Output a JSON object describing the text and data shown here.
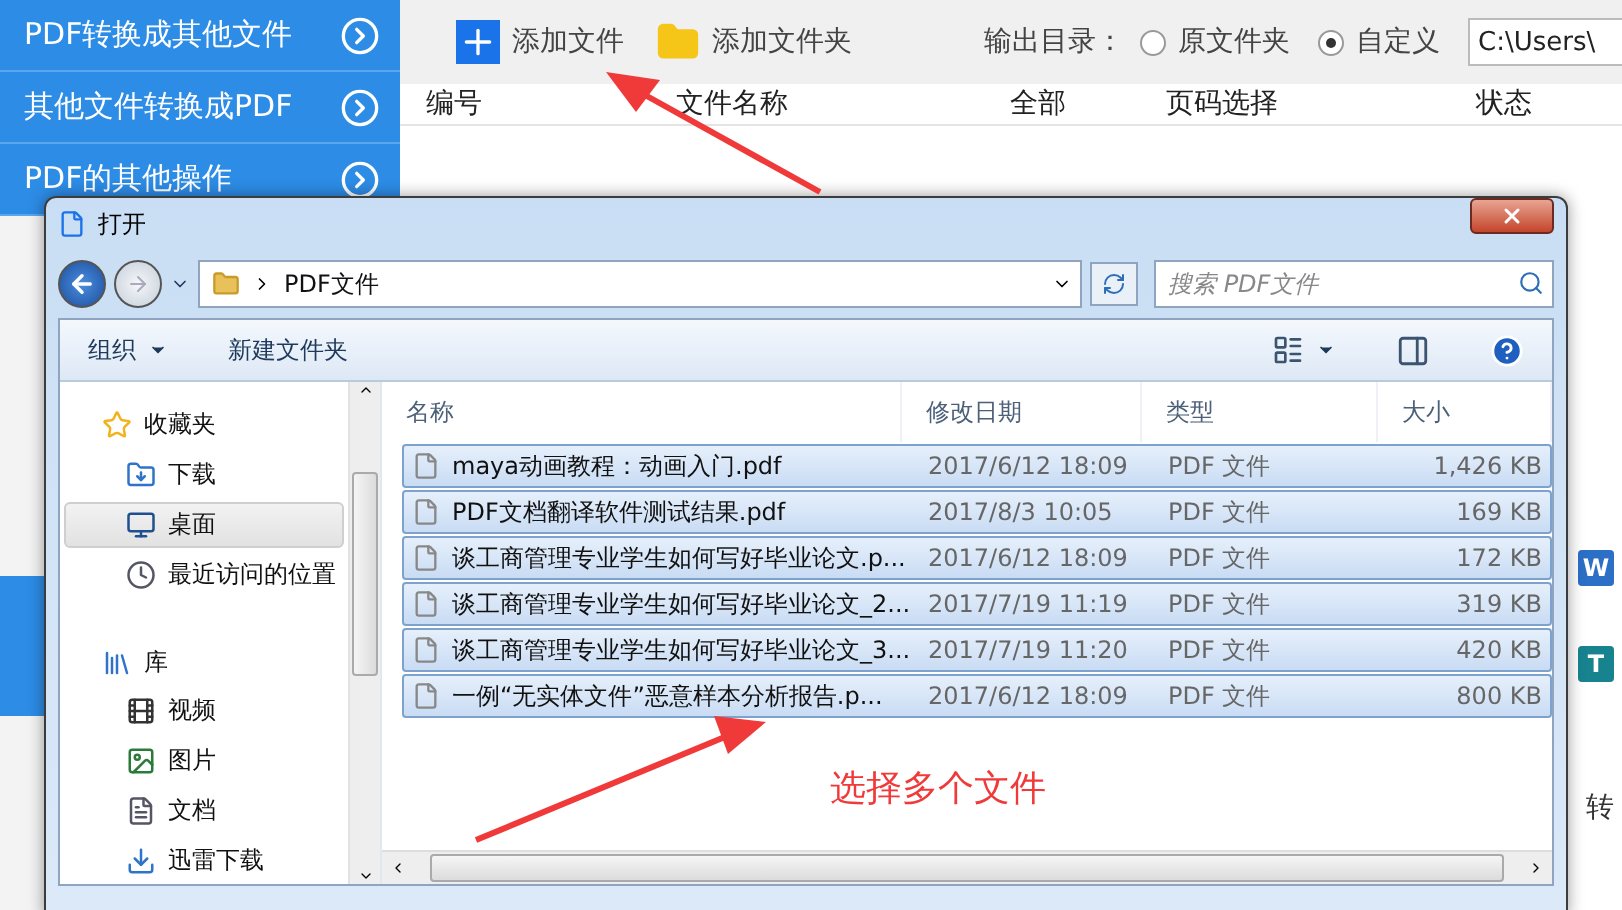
{
  "sidebar": {
    "items": [
      {
        "label": "PDF转换成其他文件"
      },
      {
        "label": "其他文件转换成PDF"
      },
      {
        "label": "PDF的其他操作"
      }
    ]
  },
  "toolbar": {
    "buttons": [
      {
        "label": "添加文件",
        "kind": "file"
      },
      {
        "label": "添加文件夹",
        "kind": "folder"
      }
    ],
    "output_label": "输出目录：",
    "options": [
      {
        "label": "原文件夹",
        "selected": false
      },
      {
        "label": "自定义",
        "selected": true
      }
    ],
    "path": "C:\\Users\\"
  },
  "table": {
    "columns": [
      "编号",
      "文件名称",
      "全部",
      "页码选择",
      "状态"
    ]
  },
  "side_panel": {
    "format_icons": [
      {
        "label": "W",
        "color": "#2b6fc6"
      },
      {
        "label": "T",
        "color": "#17838f"
      }
    ],
    "text": "转"
  },
  "dialog": {
    "title": "打开",
    "address": "PDF文件",
    "search": {
      "placeholder": "搜索 PDF文件"
    },
    "toolbar": [
      "组织",
      "新建文件夹"
    ],
    "nav": [
      {
        "label": "收藏夹",
        "kind": "favorites",
        "selected": false,
        "children": [
          {
            "label": "下载",
            "kind": "download",
            "selected": false
          },
          {
            "label": "桌面",
            "kind": "desktop",
            "selected": true
          },
          {
            "label": "最近访问的位置",
            "kind": "recent",
            "selected": false
          }
        ]
      },
      {
        "label": "库",
        "kind": "library",
        "selected": false,
        "children": [
          {
            "label": "视频",
            "kind": "video",
            "selected": false
          },
          {
            "label": "图片",
            "kind": "picture",
            "selected": false
          },
          {
            "label": "文档",
            "kind": "document",
            "selected": false
          },
          {
            "label": "迅雷下载",
            "kind": "thunder",
            "selected": false
          }
        ]
      }
    ],
    "columns": [
      "名称",
      "修改日期",
      "类型",
      "大小"
    ],
    "rows": [
      {
        "name": "maya动画教程：动画入门.pdf",
        "date": "2017/6/12 18:09",
        "type": "PDF 文件",
        "size": "1,426 KB",
        "selected": true
      },
      {
        "name": "PDF文档翻译软件测试结果.pdf",
        "date": "2017/8/3 10:05",
        "type": "PDF 文件",
        "size": "169 KB",
        "selected": true
      },
      {
        "name": "谈工商管理专业学生如何写好毕业论文.p...",
        "date": "2017/6/12 18:09",
        "type": "PDF 文件",
        "size": "172 KB",
        "selected": true
      },
      {
        "name": "谈工商管理专业学生如何写好毕业论文_2...",
        "date": "2017/7/19 11:19",
        "type": "PDF 文件",
        "size": "319 KB",
        "selected": true
      },
      {
        "name": "谈工商管理专业学生如何写好毕业论文_3...",
        "date": "2017/7/19 11:20",
        "type": "PDF 文件",
        "size": "420 KB",
        "selected": true
      },
      {
        "name": "一例“无实体文件”恶意样本分析报告.p...",
        "date": "2017/6/12 18:09",
        "type": "PDF 文件",
        "size": "800 KB",
        "selected": true
      }
    ]
  },
  "annotation": "选择多个文件"
}
